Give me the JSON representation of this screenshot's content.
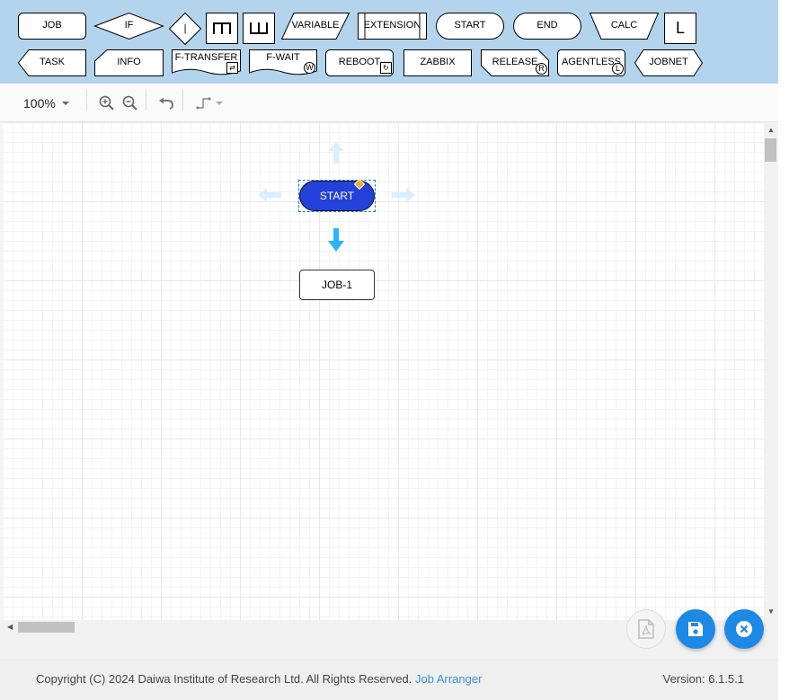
{
  "palette": {
    "row1": {
      "job": "JOB",
      "if": "IF",
      "branch": "|",
      "var": "VARIABLE",
      "extension": "EXTENSION",
      "start": "START",
      "end": "END",
      "calc": "CALC",
      "loop": "L"
    },
    "row2": {
      "task": "TASK",
      "info": "INFO",
      "ftransfer": "F-TRANSFER",
      "fwait": "F-WAIT",
      "fwait_mark": "W",
      "reboot": "REBOOT",
      "zabbix": "ZABBIX",
      "release": "RELEASE",
      "release_mark": "R",
      "agentless": "AGENTLESS",
      "agentless_mark": "L",
      "jobnet": "JOBNET"
    }
  },
  "toolbar": {
    "zoom": "100%"
  },
  "diagram": {
    "start_node": "START",
    "job_node": "JOB-1"
  },
  "colors": {
    "palette_bg": "#b3d4ec",
    "start_fill": "#2341d8",
    "accent": "#1e88e5",
    "arrow": "#29b6f6"
  },
  "footer": {
    "copyright": "Copyright (C) 2024 Daiwa Institute of Research Ltd. All Rights Reserved.",
    "link": "Job Arranger",
    "version": "Version: 6.1.5.1"
  }
}
